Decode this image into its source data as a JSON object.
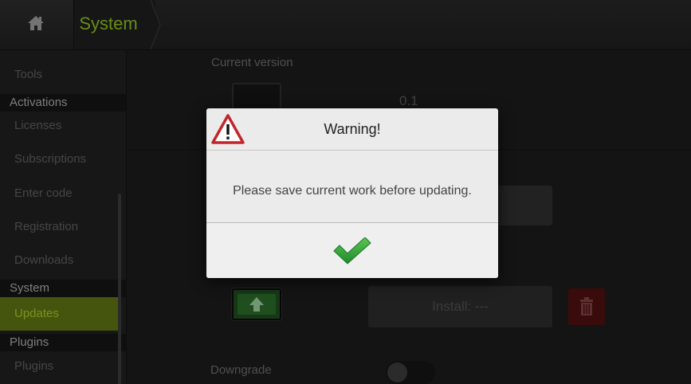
{
  "topbar": {
    "home_icon": "home-icon",
    "breadcrumb": "System",
    "accent_color": "#8cbc1c"
  },
  "sidebar": {
    "items": [
      {
        "type": "item",
        "label": "Tools"
      },
      {
        "type": "section",
        "label": "Activations"
      },
      {
        "type": "item",
        "label": "Licenses"
      },
      {
        "type": "item",
        "label": "Subscriptions"
      },
      {
        "type": "item",
        "label": "Enter code"
      },
      {
        "type": "item",
        "label": "Registration"
      },
      {
        "type": "item",
        "label": "Downloads"
      },
      {
        "type": "section",
        "label": "System"
      },
      {
        "type": "item",
        "label": "Updates",
        "active": true
      },
      {
        "type": "section",
        "label": "Plugins"
      },
      {
        "type": "item",
        "label": "Plugins"
      }
    ]
  },
  "main": {
    "current_version_label": "Current version",
    "current_version_value": "0.1",
    "install_label": "Install: ---",
    "downgrade_label": "Downgrade",
    "downgrade_enabled": false
  },
  "dialog": {
    "icon": "warning-triangle-icon",
    "title": "Warning!",
    "message": "Please save current work before updating.",
    "confirm_icon": "checkmark-icon",
    "confirm_color": "#2e9e3a"
  }
}
